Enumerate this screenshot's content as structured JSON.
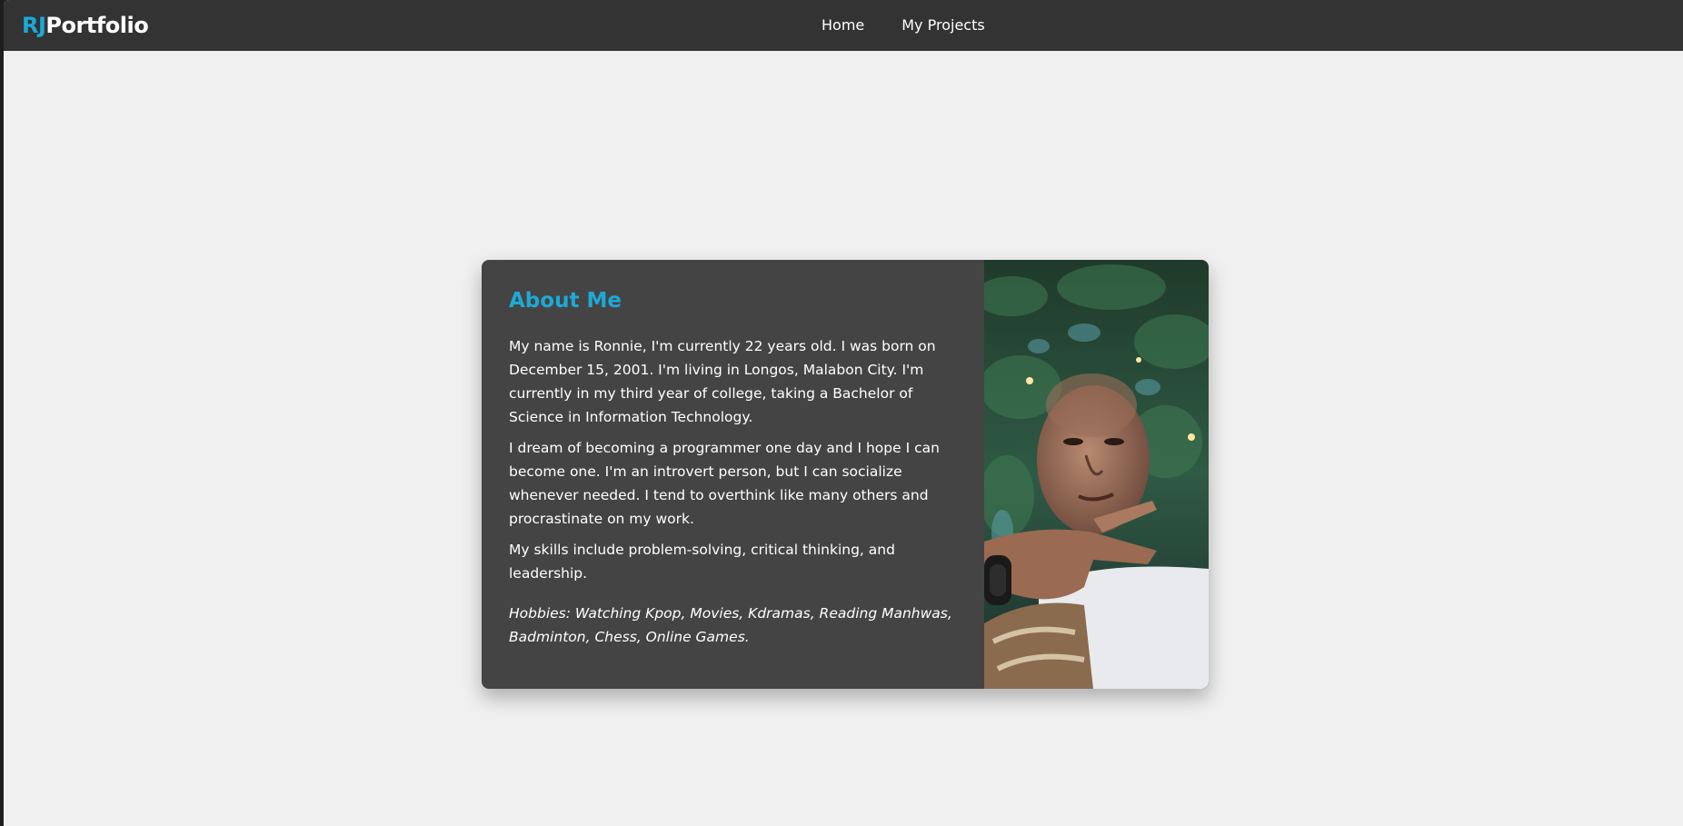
{
  "nav": {
    "logo_accent": "RJ",
    "logo_rest": "Portfolio",
    "links": [
      "Home",
      "My Projects"
    ]
  },
  "about": {
    "title": "About Me",
    "paragraphs": [
      "My name is Ronnie, I'm currently 22 years old. I was born on December 15, 2001. I'm living in Longos, Malabon City. I'm currently in my third year of college, taking a Bachelor of Science in Information Technology.",
      "I dream of becoming a programmer one day and I hope I can become one. I'm an introvert person, but I can socialize whenever needed. I tend to overthink like many others and procrastinate on my work.",
      "My skills include problem-solving, critical thinking, and leadership."
    ],
    "hobbies": "Hobbies: Watching Kpop, Movies, Kdramas, Reading Manhwas, Badminton, Chess, Online Games."
  },
  "colors": {
    "accent": "#1da9d6",
    "navbar": "#333333",
    "card": "#444444",
    "page": "#f0f0f0"
  }
}
